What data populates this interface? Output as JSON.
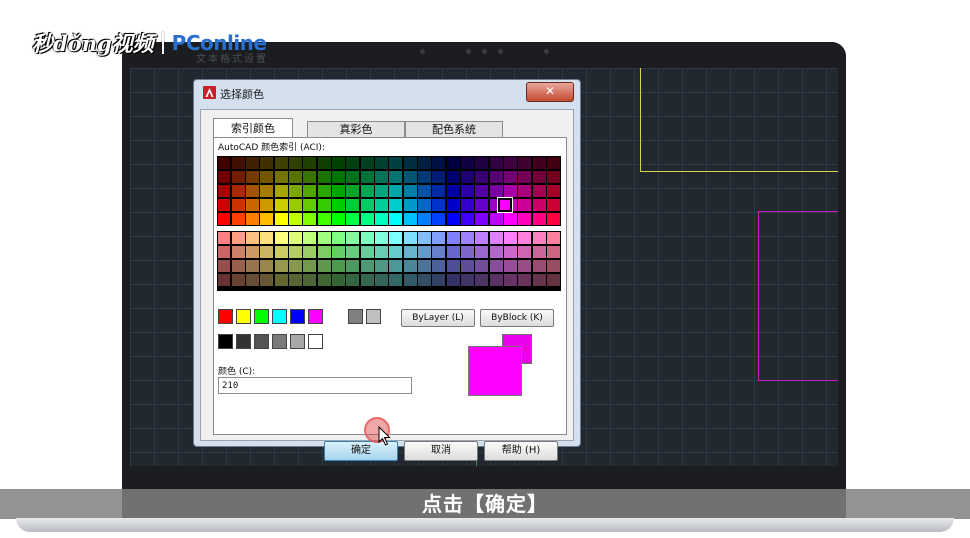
{
  "watermark": {
    "left": "秒dǒng视频",
    "right": "PConline"
  },
  "background_window": {
    "title": "文本格式设置"
  },
  "dialog": {
    "title": "选择颜色",
    "close_label": "✕",
    "tabs": [
      {
        "label": "索引颜色",
        "active": true
      },
      {
        "label": "真彩色",
        "active": false
      },
      {
        "label": "配色系统",
        "active": false
      }
    ],
    "aci_label": "AutoCAD 颜色索引 (ACI):",
    "standard_colors": [
      "#ff0000",
      "#ffff00",
      "#00ff00",
      "#00ffff",
      "#0000ff",
      "#ff00ff"
    ],
    "standard_grays": [
      "#808080",
      "#c0c0c0"
    ],
    "gray_shades": [
      "#000000",
      "#333333",
      "#545454",
      "#7a7a7a",
      "#a8a8a8",
      "#ffffff"
    ],
    "bylayer_label": "ByLayer (L)",
    "byblock_label": "ByBlock (K)",
    "color_field_label": "颜色 (C):",
    "color_value": "210",
    "selected_color": "#ff00ff",
    "buttons": {
      "ok": "确定",
      "cancel": "取消",
      "help": "帮助 (H)"
    }
  },
  "subtitle": "点击【确定】"
}
